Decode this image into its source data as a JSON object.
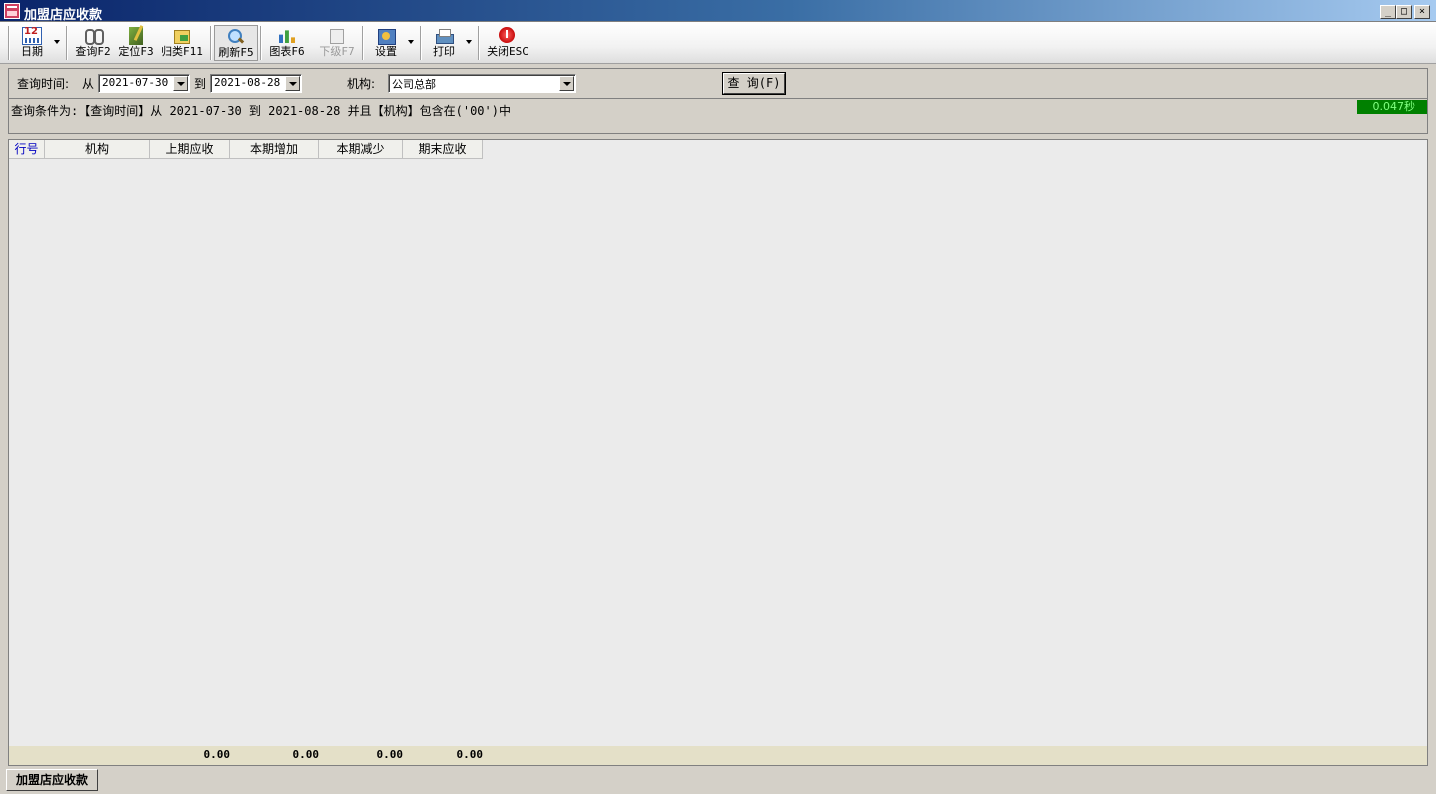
{
  "window": {
    "title": "加盟店应收款",
    "minimize": "_",
    "maximize": "□",
    "close": "×"
  },
  "toolbar": {
    "date": "日期",
    "query": "查询F2",
    "locate": "定位F3",
    "group": "归类F11",
    "refresh": "刷新F5",
    "chart": "图表F6",
    "sublevel": "下级F7",
    "settings": "设置",
    "print": "打印",
    "close": "关闭ESC"
  },
  "query": {
    "time_label": "查询时间:",
    "from_label": "从",
    "from_date": "2021-07-30",
    "to_label": "到",
    "to_date": "2021-08-28",
    "org_label": "机构:",
    "org_value": "公司总部",
    "query_button": "查 询(F)",
    "condition_text": "查询条件为:【查询时间】从 2021-07-30 到 2021-08-28 并且【机构】包含在('00')中",
    "elapsed": "0.047秒"
  },
  "grid": {
    "columns": [
      "行号",
      "机构",
      "上期应收",
      "本期增加",
      "本期减少",
      "期末应收"
    ],
    "rows": [],
    "totals": [
      "0.00",
      "0.00",
      "0.00",
      "0.00"
    ]
  },
  "tabs": {
    "active": "加盟店应收款"
  }
}
